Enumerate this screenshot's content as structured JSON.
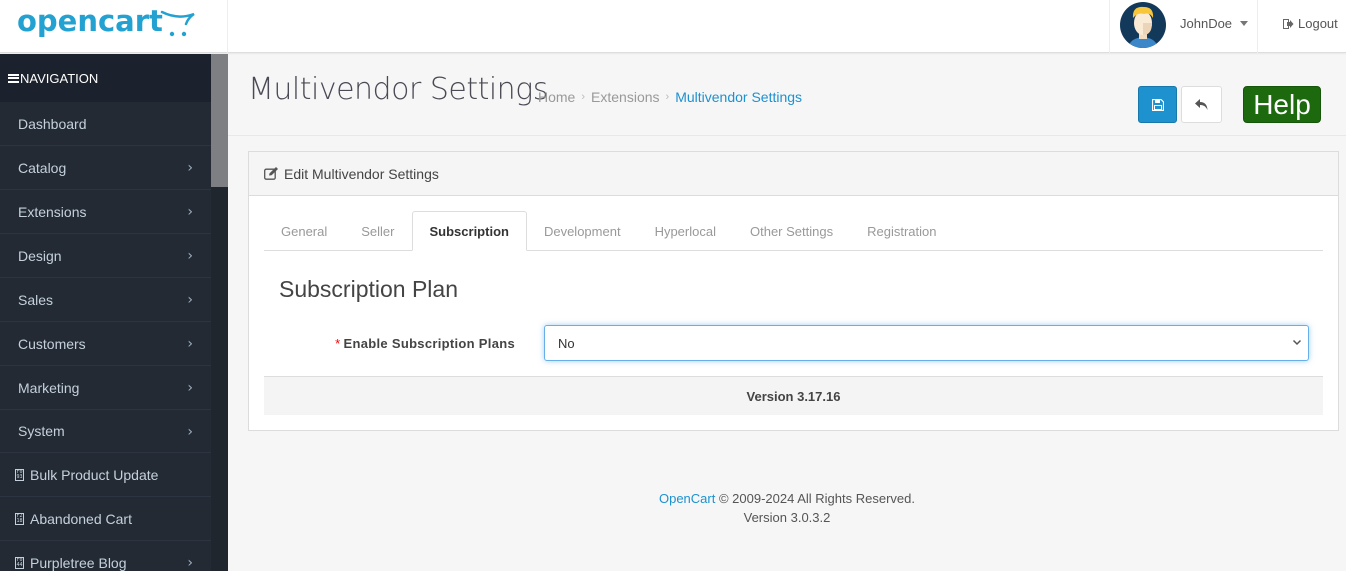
{
  "header": {
    "logo_text": "opencart",
    "username": "JohnDoe",
    "logout_label": "Logout"
  },
  "sidebar": {
    "heading": "NAVIGATION",
    "items": [
      {
        "label": "Dashboard",
        "has_children": false,
        "icon": null
      },
      {
        "label": "Catalog",
        "has_children": true,
        "icon": null
      },
      {
        "label": "Extensions",
        "has_children": true,
        "icon": null
      },
      {
        "label": "Design",
        "has_children": true,
        "icon": null
      },
      {
        "label": "Sales",
        "has_children": true,
        "icon": null
      },
      {
        "label": "Customers",
        "has_children": true,
        "icon": null
      },
      {
        "label": "Marketing",
        "has_children": true,
        "icon": null
      },
      {
        "label": "System",
        "has_children": true,
        "icon": null
      },
      {
        "label": "Bulk Product Update",
        "has_children": false,
        "icon": "F093"
      },
      {
        "label": "Abandoned Cart",
        "has_children": false,
        "icon": "F218"
      },
      {
        "label": "Purpletree Blog",
        "has_children": true,
        "icon": "F044"
      }
    ]
  },
  "page": {
    "title": "Multivendor Settings",
    "breadcrumb": [
      "Home",
      "Extensions",
      "Multivendor Settings"
    ],
    "help_label": "Help",
    "colors": {
      "primary": "#1e91cf",
      "help": "#1c6a0d",
      "sidebar_bg": "#232a34"
    }
  },
  "panel": {
    "heading": "Edit Multivendor Settings",
    "tabs": [
      {
        "label": "General",
        "active": false
      },
      {
        "label": "Seller",
        "active": false
      },
      {
        "label": "Subscription",
        "active": true
      },
      {
        "label": "Development",
        "active": false
      },
      {
        "label": "Hyperlocal",
        "active": false
      },
      {
        "label": "Other Settings",
        "active": false
      },
      {
        "label": "Registration",
        "active": false
      }
    ],
    "section_title": "Subscription Plan",
    "field_required_mark": "*",
    "field_label": "Enable Subscription Plans",
    "field_value": "No",
    "version": "Version 3.17.16"
  },
  "footer": {
    "brand": "OpenCart",
    "copyright": " © 2009-2024 All Rights Reserved.",
    "version": "Version 3.0.3.2"
  }
}
